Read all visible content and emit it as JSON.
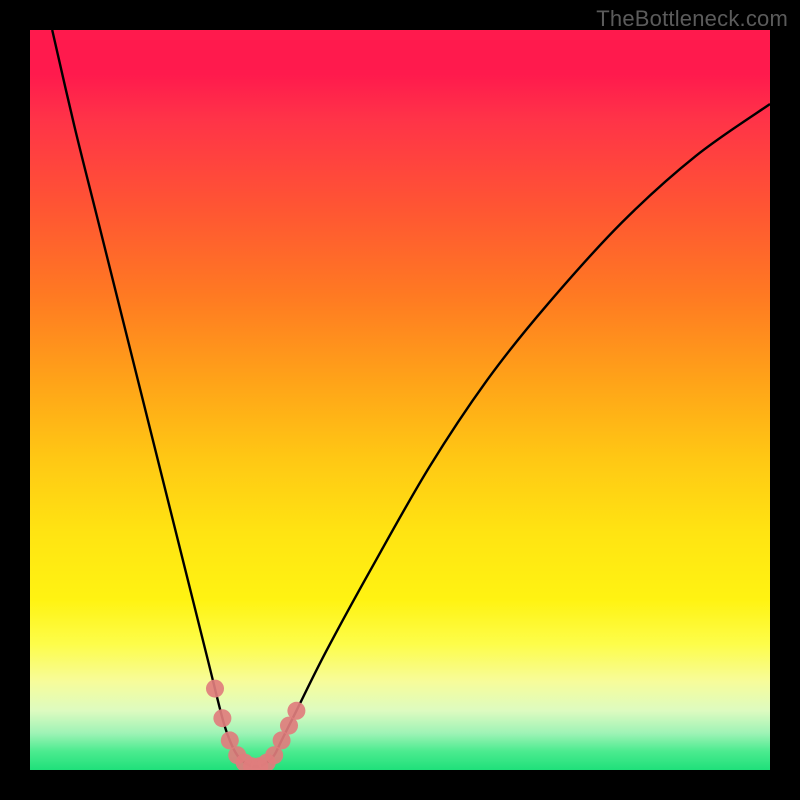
{
  "watermark": "TheBottleneck.com",
  "colors": {
    "frame": "#000000",
    "curve": "#000000",
    "marker": "#e07d7d",
    "gradient_top": "#ff1a4d",
    "gradient_bottom": "#1fe07a"
  },
  "chart_data": {
    "type": "line",
    "title": "",
    "xlabel": "",
    "ylabel": "",
    "xlim": [
      0,
      100
    ],
    "ylim": [
      0,
      100
    ],
    "grid": false,
    "legend": false,
    "annotations": [
      {
        "text": "TheBottleneck.com",
        "pos": "top-right"
      }
    ],
    "series": [
      {
        "name": "bottleneck-curve",
        "x": [
          3,
          6,
          9,
          12,
          15,
          18,
          21,
          24,
          26,
          27,
          28,
          29,
          30,
          31,
          32,
          33,
          34,
          36,
          40,
          46,
          54,
          62,
          70,
          80,
          90,
          100
        ],
        "y": [
          100,
          87,
          75,
          63,
          51,
          39,
          27,
          15,
          7,
          4,
          2,
          1,
          0.5,
          0.5,
          1,
          2,
          4,
          8,
          16,
          27,
          41,
          53,
          63,
          74,
          83,
          90
        ],
        "note": "Approximate V-shaped bottleneck curve; y is percent bottleneck (0 = no bottleneck at valley near x≈30)."
      },
      {
        "name": "highlighted-points",
        "type": "scatter",
        "x": [
          25,
          26,
          27,
          28,
          29,
          30,
          31,
          32,
          33,
          34,
          35,
          36
        ],
        "y": [
          11,
          7,
          4,
          2,
          1,
          0.5,
          0.5,
          1,
          2,
          4,
          6,
          8
        ],
        "note": "Pink marker cluster at the valley of the curve."
      }
    ],
    "background": {
      "type": "vertical-gradient",
      "meaning": "red = high bottleneck, green = low/no bottleneck",
      "stops": [
        {
          "pct": 0,
          "color": "#ff1a4d"
        },
        {
          "pct": 50,
          "color": "#ffcf14"
        },
        {
          "pct": 85,
          "color": "#fdfd4a"
        },
        {
          "pct": 100,
          "color": "#1fe07a"
        }
      ]
    }
  }
}
